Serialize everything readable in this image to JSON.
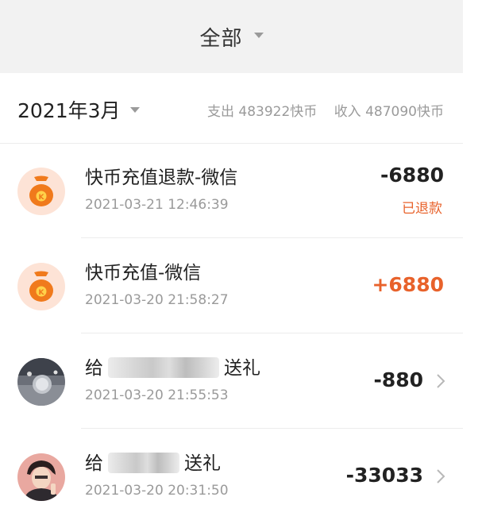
{
  "filter": {
    "label": "全部"
  },
  "summary": {
    "month": "2021年3月",
    "expense": "支出 483922快币",
    "income": "收入 487090快币"
  },
  "transactions": [
    {
      "title": "快币充值退款-微信",
      "timestamp": "2021-03-21 12:46:39",
      "amount": "-6880",
      "status": "已退款",
      "avatar": "money-bag-icon"
    },
    {
      "title": "快币充值-微信",
      "timestamp": "2021-03-20 21:58:27",
      "amount": "+6880",
      "avatar": "money-bag-icon"
    },
    {
      "title_prefix": "给",
      "title_suffix": "送礼",
      "timestamp": "2021-03-20 21:55:53",
      "amount": "-880",
      "avatar": "user-avatar"
    },
    {
      "title_prefix": "给",
      "title_suffix": "送礼",
      "timestamp": "2021-03-20 20:31:50",
      "amount": "-33033",
      "avatar": "user-avatar"
    }
  ],
  "colors": {
    "accent": "#e8622b",
    "coin": "#f07a1c",
    "header_bg": "#f2f2f2"
  }
}
